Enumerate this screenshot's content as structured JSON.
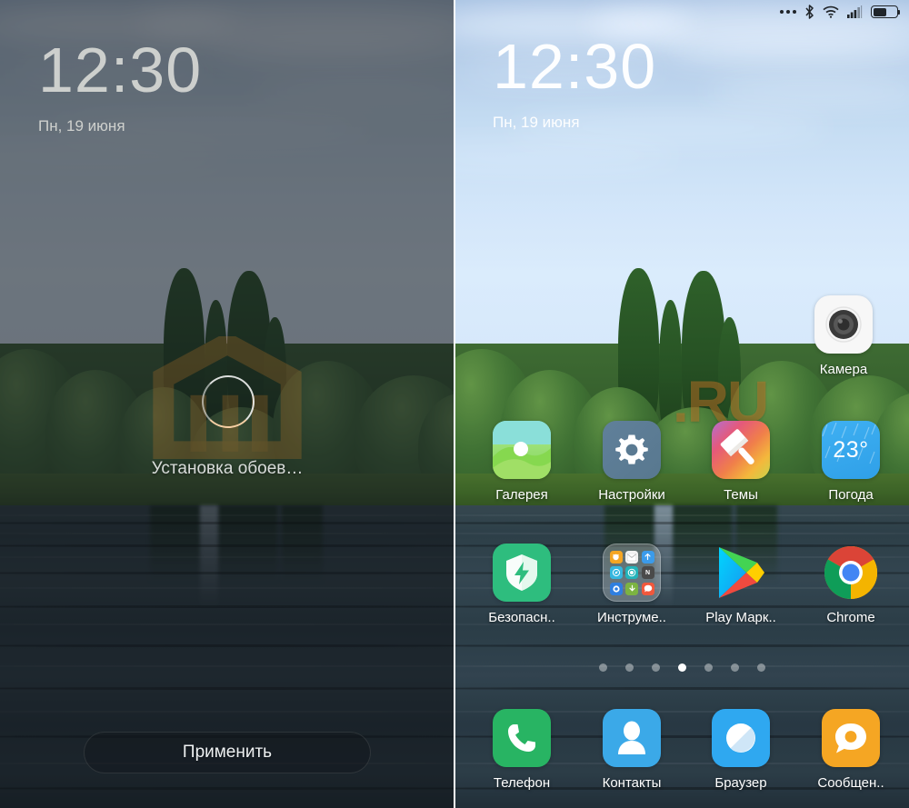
{
  "lockscreen": {
    "time": "12:30",
    "date": "Пн, 19 июня",
    "status_text": "Установка обоев…",
    "apply_button": "Применить",
    "spinner_icon": "loading-spinner-icon",
    "watermark_icon": "mi-logo-watermark"
  },
  "homescreen": {
    "time": "12:30",
    "date": "Пн, 19 июня",
    "watermark_text": ".RU",
    "statusbar": {
      "more_icon": "more-dots-icon",
      "bluetooth_icon": "bluetooth-icon",
      "wifi_icon": "wifi-icon",
      "signal_icon": "cellular-signal-icon",
      "battery_icon": "battery-icon"
    },
    "camera_shortcut": {
      "label": "Камера",
      "icon": "camera-icon"
    },
    "rows": [
      [
        {
          "label": "Галерея",
          "icon": "gallery-icon"
        },
        {
          "label": "Настройки",
          "icon": "settings-gear-icon"
        },
        {
          "label": "Темы",
          "icon": "themes-brush-icon"
        },
        {
          "label": "Погода",
          "icon": "weather-icon",
          "value": "23°"
        }
      ],
      [
        {
          "label": "Безопасн..",
          "icon": "security-shield-icon"
        },
        {
          "label": "Инструме..",
          "icon": "tools-folder-icon"
        },
        {
          "label": "Play Марк..",
          "icon": "play-store-icon"
        },
        {
          "label": "Chrome",
          "icon": "chrome-icon"
        }
      ]
    ],
    "dock": [
      {
        "label": "Телефон",
        "icon": "phone-icon"
      },
      {
        "label": "Контакты",
        "icon": "contacts-icon"
      },
      {
        "label": "Браузер",
        "icon": "browser-compass-icon"
      },
      {
        "label": "Сообщен..",
        "icon": "messages-icon"
      }
    ],
    "page_indicator": {
      "total": 7,
      "active": 4
    }
  },
  "colors": {
    "security_green": "#2ebd7e",
    "phone_green": "#28b463",
    "contacts_blue": "#3ba9e8",
    "browser_blue": "#2fa8f0",
    "messages_orange": "#f5a623",
    "weather_blue": "#35aaf0",
    "settings_slate": "#5d7b95"
  }
}
